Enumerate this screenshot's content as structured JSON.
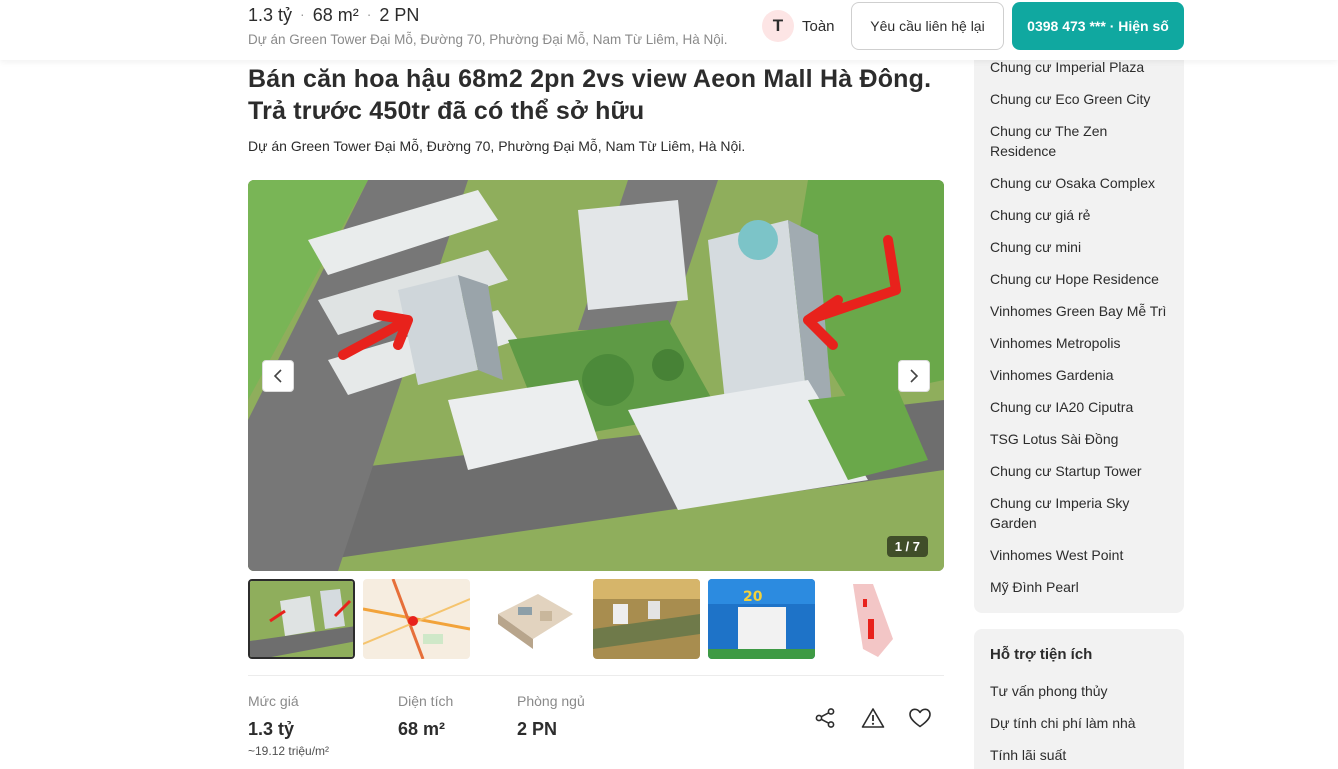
{
  "header": {
    "price": "1.3 tỷ",
    "area": "68 m²",
    "bedrooms": "2 PN",
    "address": "Dự án Green Tower Đại Mỗ, Đường 70, Phường Đại Mỗ, Nam Từ Liêm, Hà Nội.",
    "agent_initial": "T",
    "agent_name": "Toàn",
    "contact_button": "Yêu cầu liên hệ lại",
    "phone_button": "0398 473 *** · Hiện số"
  },
  "listing": {
    "title": "Bán căn hoa hậu 68m2 2pn 2vs view Aeon Mall Hà Đông. Trả trước 450tr đã có thể sở hữu",
    "address": "Dự án Green Tower Đại Mỗ, Đường 70, Phường Đại Mỗ, Nam Từ Liêm, Hà Nội.",
    "image_counter": "1 / 7",
    "thumbnails": [
      "aerial-render",
      "location-map",
      "floor-plan-3d",
      "area-overview",
      "promo-banner",
      "site-plan"
    ]
  },
  "stats": {
    "price_label": "Mức giá",
    "price_value": "1.3 tỷ",
    "price_sub": "~19.12 triệu/m²",
    "area_label": "Diện tích",
    "area_value": "68 m²",
    "bed_label": "Phòng ngủ",
    "bed_value": "2 PN"
  },
  "icons": {
    "share": "share-icon",
    "report": "warning-icon",
    "save": "heart-icon"
  },
  "sidebar": {
    "projects": [
      "Chung cư Imperial Plaza",
      "Chung cư Eco Green City",
      "Chung cư The Zen Residence",
      "Chung cư Osaka Complex",
      "Chung cư giá rẻ",
      "Chung cư mini",
      "Chung cư Hope Residence",
      "Vinhomes Green Bay Mễ Trì",
      "Vinhomes Metropolis",
      "Vinhomes Gardenia",
      "Chung cư IA20 Ciputra",
      "TSG Lotus Sài Đồng",
      "Chung cư Startup Tower",
      "Chung cư Imperia Sky Garden",
      "Vinhomes West Point",
      "Mỹ Đình Pearl"
    ],
    "utilities_title": "Hỗ trợ tiện ích",
    "utilities": [
      "Tư vấn phong thủy",
      "Dự tính chi phí làm nhà",
      "Tính lãi suất"
    ]
  },
  "colors": {
    "accent": "#10a8a0",
    "text": "#2c2c2c",
    "muted": "#8a8a8a",
    "sidebar_bg": "#f2f2f2"
  }
}
